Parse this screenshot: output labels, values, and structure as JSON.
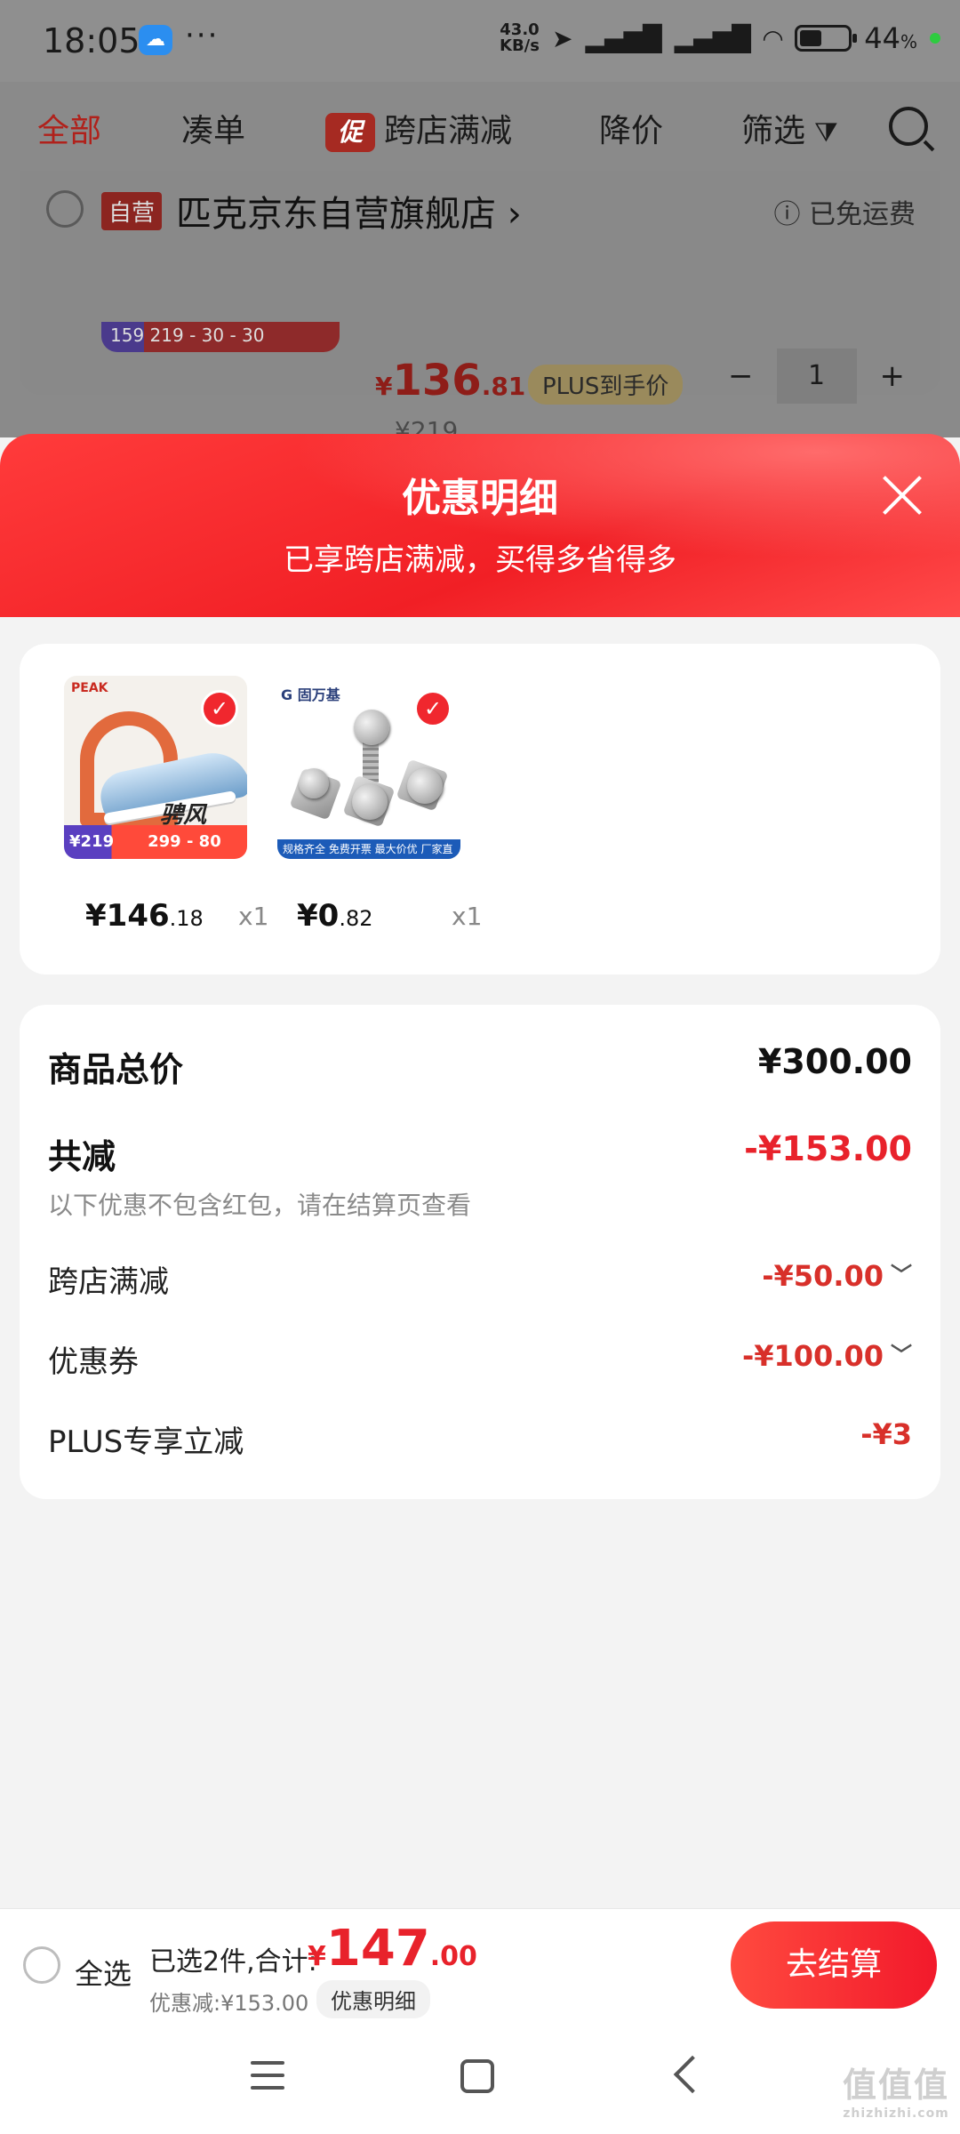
{
  "status_bar": {
    "time": "18:05",
    "dots": "···",
    "net_speed_value": "43.0",
    "net_speed_unit": "KB/s",
    "battery": "44",
    "battery_unit": "%"
  },
  "tabs": {
    "all": "全部",
    "bundle": "凑单",
    "promo_badge": "促",
    "cross_store": "跨店满减",
    "price_drop": "降价",
    "filter": "筛选"
  },
  "store": {
    "self_tag": "自营",
    "name": "匹克京东自营旗舰店",
    "arrow": "›",
    "free_shipping": "ⓘ 已免运费",
    "thumb_strip": "159   219 - 30 - 30",
    "price_symbol": "¥",
    "price_int": "136",
    "price_dec": ".81",
    "plus_tag": "PLUS到手价",
    "quantity": "1",
    "minus": "−",
    "plus": "+",
    "original_price": "¥219"
  },
  "modal": {
    "title": "优惠明细",
    "subtitle": "已享跨店满减，买得多省得多"
  },
  "products": [
    {
      "logo": "PEAK",
      "name_art": "骋风",
      "strip_left": "¥219",
      "strip_right": "299 - 80",
      "price_int": "¥146",
      "price_dec": ".18",
      "qty": "x1"
    },
    {
      "logo": "G 固万基",
      "strip": "规格齐全 免费开票 最大价优 厂家直销",
      "price_int": "¥0",
      "price_dec": ".82",
      "qty": "x1"
    }
  ],
  "summary": {
    "total_label": "商品总价",
    "total_value": "¥300.00",
    "discount_label": "共减",
    "discount_value": "-¥153.00",
    "note": "以下优惠不包含红包，请在结算页查看",
    "items": [
      {
        "label": "跨店满减",
        "value": "-¥50.00",
        "chevron": "﹀"
      },
      {
        "label": "优惠券",
        "value": "-¥100.00",
        "chevron": "﹀"
      },
      {
        "label": "PLUS专享立减",
        "value": "-¥3"
      }
    ]
  },
  "bottom_bar": {
    "select_all": "全选",
    "selected_text": "已选2件,合计:",
    "total_symbol": "¥",
    "total_int": "147",
    "total_dec": ".00",
    "discount_text": "优惠减:¥153.00",
    "detail_btn": "优惠明细",
    "checkout": "去结算"
  },
  "watermark": {
    "logo": "值值值",
    "url": "zhizhizhi.com"
  },
  "colors": {
    "accent_red": "#e8222b",
    "header_red": "#f11f25"
  }
}
